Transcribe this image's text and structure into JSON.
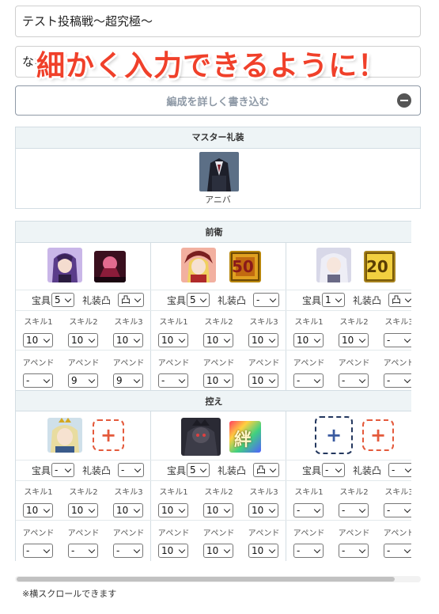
{
  "form": {
    "title_value": "テスト投稿戦〜超究極〜",
    "name_value": "なな",
    "banner_text": "細かく入力できるように！",
    "detail_button_label": "編成を詳しく書き込む"
  },
  "master": {
    "header": "マスター礼装",
    "costume_label": "アニバ"
  },
  "team": {
    "front_header": "前衛",
    "back_header": "控え",
    "np_label": "宝具",
    "ce_label": "礼装凸",
    "skill_labels": [
      "スキル1",
      "スキル2",
      "スキル3"
    ],
    "append_label": "アペンド",
    "front": [
      {
        "np": "5",
        "ce_limit": "凸",
        "skills": [
          "10",
          "10",
          "10"
        ],
        "appends": [
          "-",
          "9",
          "9"
        ]
      },
      {
        "np": "5",
        "ce_limit": "-",
        "skills": [
          "10",
          "10",
          "10"
        ],
        "appends": [
          "-",
          "10",
          "10"
        ],
        "ce_level": "50"
      },
      {
        "np": "1",
        "ce_limit": "凸",
        "skills": [
          "10",
          "10",
          "-"
        ],
        "appends": [
          "-",
          "-",
          "-"
        ],
        "ce_level": "20"
      }
    ],
    "back": [
      {
        "np": "-",
        "ce_limit": "-",
        "skills": [
          "10",
          "10",
          "10"
        ],
        "appends": [
          "-",
          "-",
          "-"
        ]
      },
      {
        "np": "5",
        "ce_limit": "凸",
        "skills": [
          "10",
          "10",
          "10"
        ],
        "appends": [
          "10",
          "10",
          "10"
        ],
        "ce_glyph": "絆"
      },
      {
        "np": "-",
        "ce_limit": "-",
        "skills": [
          "-",
          "-",
          "-"
        ],
        "appends": [
          "-",
          "-",
          "-"
        ]
      }
    ]
  },
  "footer": {
    "note": "※横スクロールできます"
  },
  "colors": {
    "accent_red": "#f0402a",
    "header_bg": "#eef4f6",
    "border": "#d3dde3",
    "add_orange": "#e45a3c",
    "add_navy": "#23375e"
  }
}
